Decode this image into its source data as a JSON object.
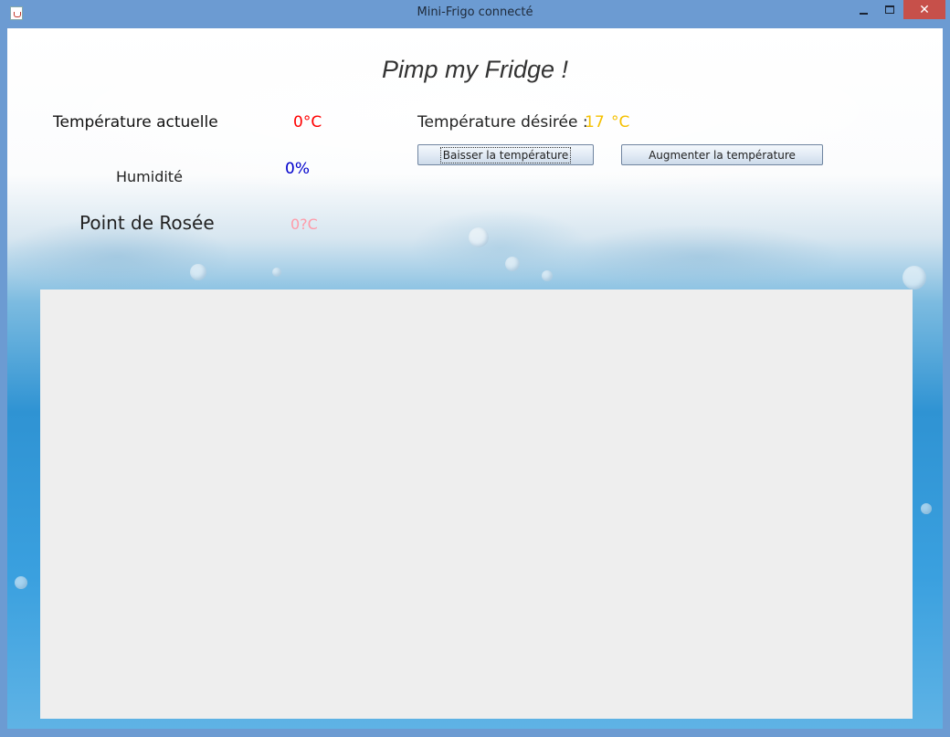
{
  "window": {
    "title": "Mini-Frigo connecté",
    "close_symbol": "✕"
  },
  "icons": {
    "app": "java-app-icon",
    "minimize": "minimize-icon",
    "maximize": "maximize-icon",
    "close": "close-icon"
  },
  "main": {
    "heading": "Pimp my Fridge !",
    "current_temp_label": "Température actuelle",
    "current_temp_value": "0°C",
    "humidity_label": "Humidité",
    "humidity_value": "0%",
    "dew_point_label": "Point de Rosée",
    "dew_point_value": "0?C",
    "desired_temp_label": "Température désirée :",
    "desired_temp_value": "17",
    "desired_temp_unit": "°C",
    "lower_button": "Baisser la température",
    "raise_button": "Augmenter la température"
  },
  "colors": {
    "current_temp": "#ff0000",
    "humidity": "#0000cc",
    "dew_point": "#ff9aa8",
    "desired_temp": "#f5c000",
    "panel": "#eeeeee",
    "window_frame": "#6c9bd2",
    "close_button": "#c7504a"
  }
}
